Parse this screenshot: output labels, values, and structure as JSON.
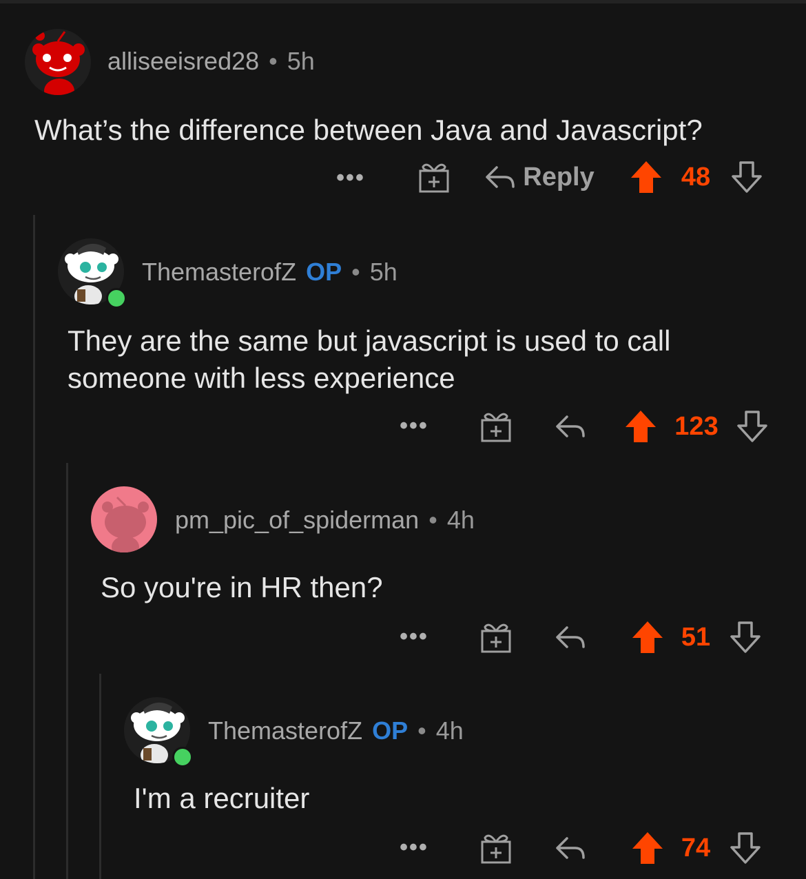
{
  "comments": [
    {
      "username": "alliseeisred28",
      "op_label": "",
      "separator": "•",
      "time": "5h",
      "text_lines": [
        "What’s the difference between Java and Javascript?"
      ],
      "more_label": "•••",
      "reply_label": "Reply",
      "score": "48",
      "avatar_icon": "red-snoo-avatar-icon",
      "colors": {
        "upvote": "#ff4500",
        "avatar_bg": "#1f1f1f"
      }
    },
    {
      "username": "ThemasterofZ",
      "op_label": "OP",
      "separator": "•",
      "time": "5h",
      "text_lines": [
        "They are the same but javascript is used to call",
        "someone with less experience"
      ],
      "more_label": "•••",
      "reply_label": "",
      "score": "123",
      "avatar_icon": "white-snoo-avatar-icon",
      "online": true
    },
    {
      "username": "pm_pic_of_spiderman",
      "op_label": "",
      "separator": "•",
      "time": "4h",
      "text_lines": [
        "So you're in HR then?"
      ],
      "more_label": "•••",
      "reply_label": "",
      "score": "51",
      "avatar_icon": "pink-snoo-avatar-icon",
      "colors": {
        "avatar_bg": "#f07a8a"
      }
    },
    {
      "username": "ThemasterofZ",
      "op_label": "OP",
      "separator": "•",
      "time": "4h",
      "text_lines": [
        "I'm a recruiter"
      ],
      "more_label": "•••",
      "reply_label": "",
      "score": "74",
      "avatar_icon": "white-snoo-avatar-icon",
      "online": true
    }
  ],
  "colors": {
    "background": "#141414",
    "op": "#2f7fd6",
    "score": "#ff4500",
    "online": "#46d160"
  }
}
